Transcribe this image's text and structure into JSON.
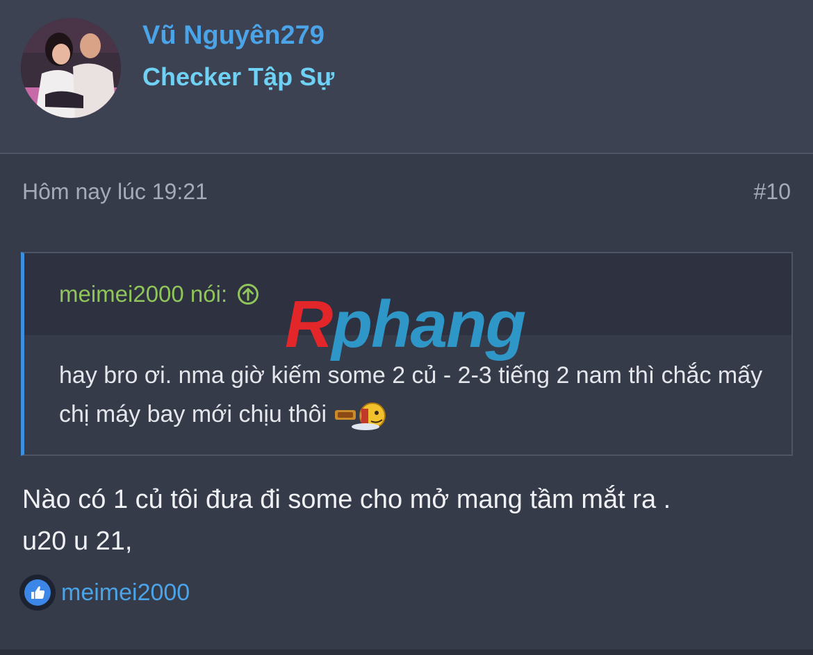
{
  "user": {
    "name": "Vũ Nguyên279",
    "title": "Checker Tập Sự"
  },
  "post": {
    "time": "Hôm nay lúc 19:21",
    "number": "#10",
    "quote": {
      "author_label": "meimei2000 nói:",
      "text": "hay bro ơi. nma giờ kiếm some 2 củ - 2-3 tiếng 2 nam thì chắc mấy chị máy bay mới chịu thôi"
    },
    "body_line1": "Nào có 1 củ tôi đưa đi some cho mở mang tầm mắt ra .",
    "body_line2": "u20 u 21,",
    "reaction": {
      "icon": "like-icon",
      "user": "meimei2000"
    }
  },
  "watermark": {
    "first": "R",
    "rest": "phang"
  },
  "colors": {
    "background": "#363b4a",
    "header_bg": "#3d4252",
    "username": "#4ba3e8",
    "user_title": "#6fd1f4",
    "quote_author": "#8fc55a",
    "quote_border": "#3f8fe0"
  }
}
